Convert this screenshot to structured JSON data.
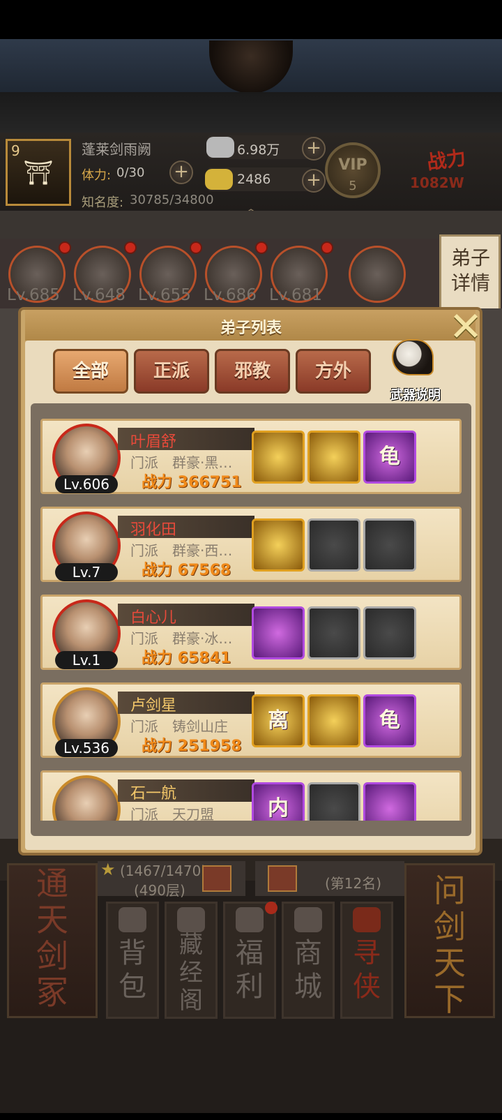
{
  "player": {
    "level": "9",
    "sect_name": "蓬莱剑雨阙",
    "stamina_label": "体力:",
    "stamina_value": "0/30",
    "fame_label": "知名度:",
    "fame_value": "30785/34800",
    "silver": "6.98万",
    "gold": "2486",
    "vip_label": "VIP",
    "vip_level": "5",
    "power_label": "战力",
    "power_value": "1082W"
  },
  "hero_strip": {
    "levels": [
      "Lv.685",
      "Lv.648",
      "Lv.655",
      "Lv.686",
      "Lv.681"
    ],
    "detail_button": "弟子详情"
  },
  "popup": {
    "title": "弟子列表",
    "close_icon": "close-x-icon",
    "tabs": [
      "全部",
      "正派",
      "邪教",
      "方外"
    ],
    "active_tab": "全部",
    "weapon_info_label": "武器说明",
    "disciples": [
      {
        "name": "叶眉舒",
        "level": "Lv.606",
        "sect": "门派　群豪·黑…",
        "power": "战力 366751",
        "skills": [
          "gold",
          "gold",
          "purple"
        ],
        "skill_glyphs": [
          "",
          "",
          "龟"
        ]
      },
      {
        "name": "羽化田",
        "level": "Lv.7",
        "sect": "门派　群豪·西…",
        "power": "战力 67568",
        "skills": [
          "gold",
          "empty",
          "empty"
        ],
        "skill_glyphs": [
          "",
          "",
          ""
        ]
      },
      {
        "name": "白心儿",
        "level": "Lv.1",
        "sect": "门派　群豪·冰…",
        "power": "战力 65841",
        "skills": [
          "purple",
          "empty",
          "empty"
        ],
        "skill_glyphs": [
          "",
          "",
          ""
        ]
      },
      {
        "name": "卢剑星",
        "level": "Lv.536",
        "sect": "门派　铸剑山庄",
        "power": "战力 251958",
        "skills": [
          "gold",
          "gold",
          "purple"
        ],
        "skill_glyphs": [
          "离",
          "",
          "龟"
        ]
      },
      {
        "name": "石一航",
        "level": "",
        "sect": "门派　天刀盟",
        "power": "",
        "skills": [
          "purple",
          "empty",
          "purple"
        ],
        "skill_glyphs": [
          "内",
          "",
          ""
        ]
      }
    ]
  },
  "bottom": {
    "rank_progress": "(1467/1470)",
    "rank_floor": "(490层)",
    "rank_position": "(第12名)",
    "left_banner": "通天剑冢",
    "right_banner": "问剑天下",
    "menu": [
      "背包",
      "藏经阁",
      "福利",
      "商城",
      "寻侠"
    ]
  },
  "colors": {
    "accent_red": "#c8281a",
    "power_orange": "#f08a1a",
    "panel_tan": "#c9a66a"
  }
}
